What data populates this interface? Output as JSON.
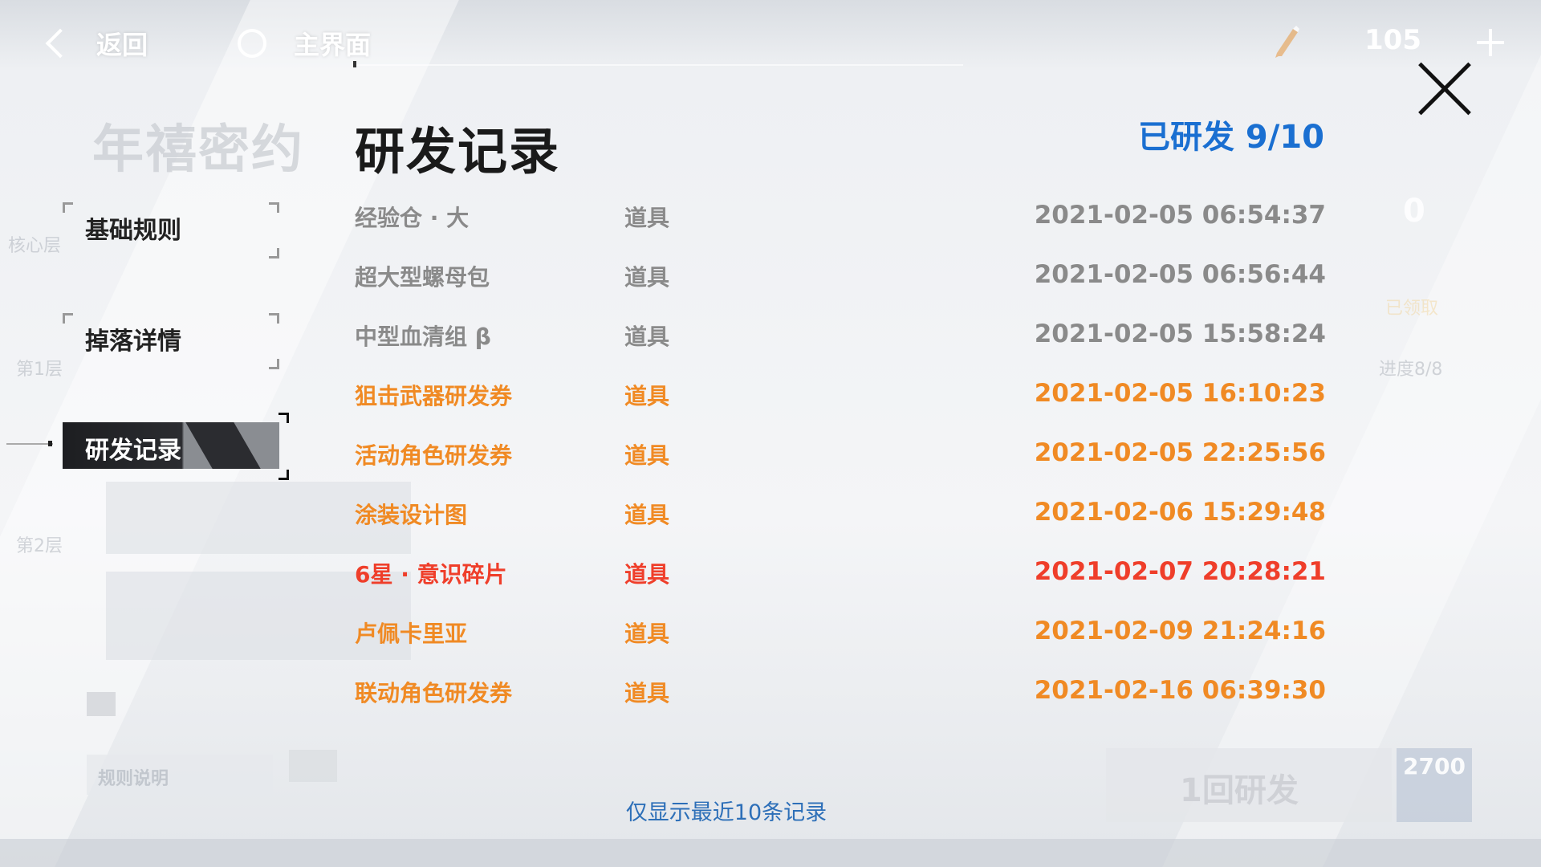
{
  "topbar": {
    "back_label": "返回",
    "home_label": "主界面",
    "currency_value": "105"
  },
  "background": {
    "event_title": "年禧密约",
    "core_layer": "核心层",
    "layer1": "第1层",
    "layer2": "第2层",
    "claimed": "已领取",
    "progress": "进度8/8",
    "right_zero": "0",
    "rule_button": "规则说明",
    "develop_button": "1回研发",
    "cost": "2700"
  },
  "tabs": [
    {
      "label": "基础规则",
      "active": false
    },
    {
      "label": "掉落详情",
      "active": false
    },
    {
      "label": "研发记录",
      "active": true
    }
  ],
  "panel": {
    "title": "研发记录",
    "progress_label": "已研发 9/10",
    "footnote": "仅显示最近10条记录"
  },
  "records": [
    {
      "name": "经验仓 · 大",
      "type": "道具",
      "time": "2021-02-05 06:54:37",
      "color": "#8a8a8a"
    },
    {
      "name": "超大型螺母包",
      "type": "道具",
      "time": "2021-02-05 06:56:44",
      "color": "#8a8a8a"
    },
    {
      "name": "中型血清组 β",
      "type": "道具",
      "time": "2021-02-05 15:58:24",
      "color": "#8a8a8a"
    },
    {
      "name": "狙击武器研发券",
      "type": "道具",
      "time": "2021-02-05 16:10:23",
      "color": "#f08a24"
    },
    {
      "name": "活动角色研发券",
      "type": "道具",
      "time": "2021-02-05 22:25:56",
      "color": "#f08a24"
    },
    {
      "name": "涂装设计图",
      "type": "道具",
      "time": "2021-02-06 15:29:48",
      "color": "#f08a24"
    },
    {
      "name": "6星 · 意识碎片",
      "type": "道具",
      "time": "2021-02-07 20:28:21",
      "color": "#ef3e2a"
    },
    {
      "name": "卢佩卡里亚",
      "type": "道具",
      "time": "2021-02-09 21:24:16",
      "color": "#f08a24"
    },
    {
      "name": "联动角色研发券",
      "type": "道具",
      "time": "2021-02-16 06:39:30",
      "color": "#f08a24"
    }
  ],
  "colors": {
    "accent_blue": "#1a6fd1",
    "orange": "#f08a24",
    "red": "#ef3e2a",
    "gray": "#8a8a8a"
  },
  "icons": {
    "back": "chevron-left-icon",
    "home": "circle-home-icon",
    "currency": "pen-currency-icon",
    "add": "plus-icon",
    "close": "close-icon"
  }
}
